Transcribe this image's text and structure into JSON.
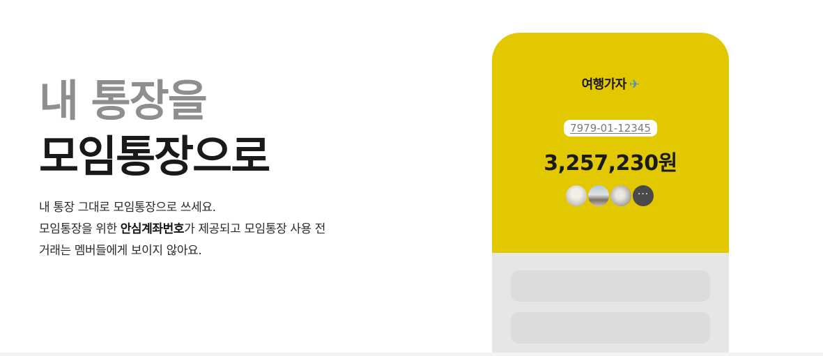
{
  "hero": {
    "headline_line1": "내 통장을",
    "headline_line2": "모임통장으로",
    "desc_line1": "내 통장 그대로 모임통장으로 쓰세요.",
    "desc_line2_before": "모임통장을 위한 ",
    "desc_line2_bold": "안심계좌번호",
    "desc_line2_after": "가 제공되고 모임통장 사용 전",
    "desc_line3": "거래는 멤버들에게 보이지 않아요."
  },
  "phone": {
    "group_name": "여행가자",
    "group_icon": "airplane-icon",
    "account_number": "7979-01-12345",
    "balance": "3,257,230원",
    "members": [
      "member-avatar-1",
      "member-avatar-2",
      "member-avatar-3"
    ],
    "more_label": "···",
    "colors": {
      "accent": "#e2c800",
      "card_bg": "#e6e6e6"
    }
  }
}
